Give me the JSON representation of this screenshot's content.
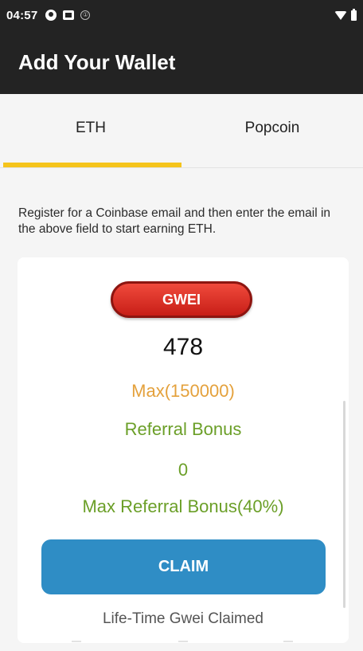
{
  "status_bar": {
    "time": "04:57",
    "info_glyph": "①",
    "icons": [
      "circle-app-icon",
      "screen-record-icon",
      "info-icon",
      "wifi-icon",
      "battery-icon"
    ]
  },
  "app_bar": {
    "title": "Add Your Wallet"
  },
  "tabs": [
    {
      "label": "ETH",
      "active": true
    },
    {
      "label": "Popcoin",
      "active": false
    }
  ],
  "instructions": "Register for a Coinbase email and then enter the email in the above field to start earning ETH.",
  "card": {
    "badge": "GWEI",
    "gwei_value": "478",
    "max_text": "Max(150000)",
    "referral_label": "Referral Bonus",
    "referral_value": "0",
    "max_referral_label": "Max Referral Bonus(40%)",
    "claim_label": "CLAIM",
    "lifetime_label": "Life-Time Gwei Claimed"
  },
  "colors": {
    "header": "#232323",
    "tab_indicator": "#f5c41c",
    "badge": "#d9281f",
    "max_text": "#e4a13c",
    "referral_text": "#6b9f28",
    "claim_button": "#2f8dc5"
  }
}
